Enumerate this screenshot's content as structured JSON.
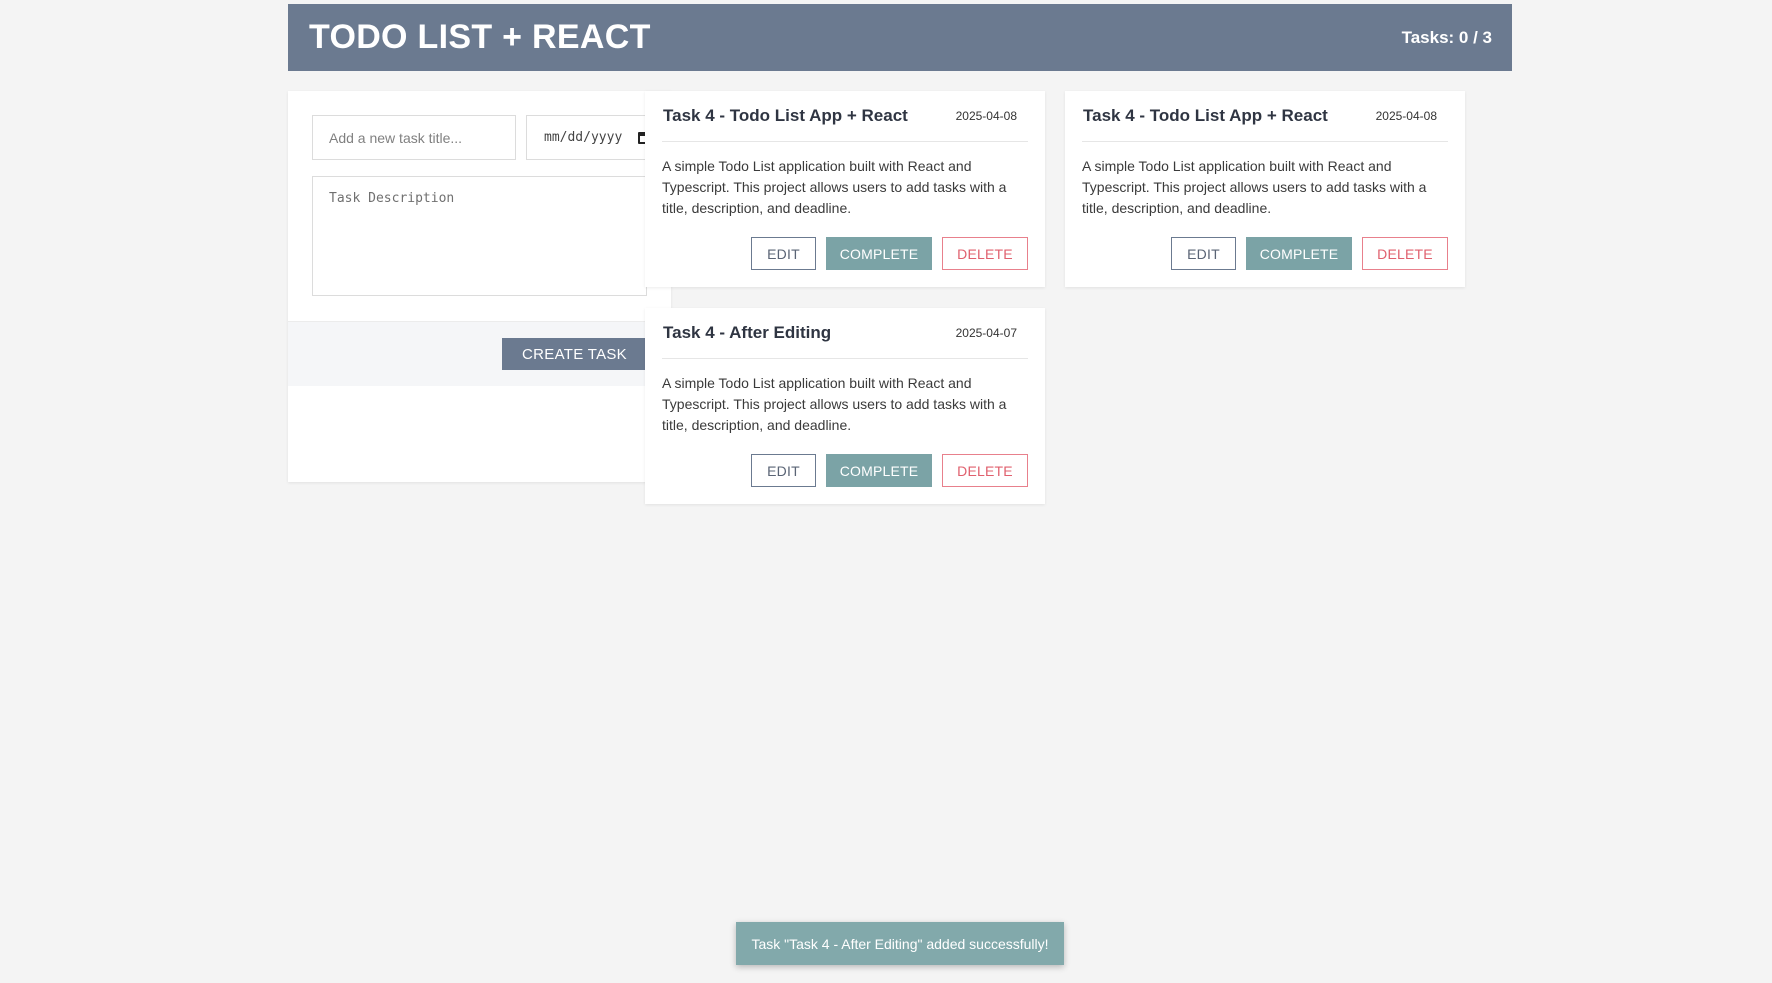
{
  "header": {
    "title": "TODO LIST + REACT",
    "task_count": "Tasks: 0 / 3"
  },
  "form": {
    "title_placeholder": "Add a new task title...",
    "date_placeholder": "mm/dd/yyyy",
    "description_placeholder": "Task Description",
    "create_label": "CREATE TASK"
  },
  "tasks": [
    {
      "title": "Task 4 - Todo List App + React",
      "date": "2025-04-08",
      "description": "A simple Todo List application built with React and Typescript. This project allows users to add tasks with a title, description, and deadline.",
      "edit_label": "EDIT",
      "complete_label": "COMPLETE",
      "delete_label": "DELETE"
    },
    {
      "title": "Task 4 - Todo List App + React",
      "date": "2025-04-08",
      "description": "A simple Todo List application built with React and Typescript. This project allows users to add tasks with a title, description, and deadline.",
      "edit_label": "EDIT",
      "complete_label": "COMPLETE",
      "delete_label": "DELETE"
    },
    {
      "title": "Task 4 - After Editing",
      "date": "2025-04-07",
      "description": "A simple Todo List application built with React and Typescript. This project allows users to add tasks with a title, description, and deadline.",
      "edit_label": "EDIT",
      "complete_label": "COMPLETE",
      "delete_label": "DELETE"
    }
  ],
  "toast": {
    "message": "Task \"Task 4 - After Editing\" added successfully!"
  },
  "colors": {
    "header_bg": "#6b7a90",
    "complete_bg": "#7ba3a6",
    "delete_text": "#e0606e",
    "toast_bg": "#82a9ab"
  }
}
